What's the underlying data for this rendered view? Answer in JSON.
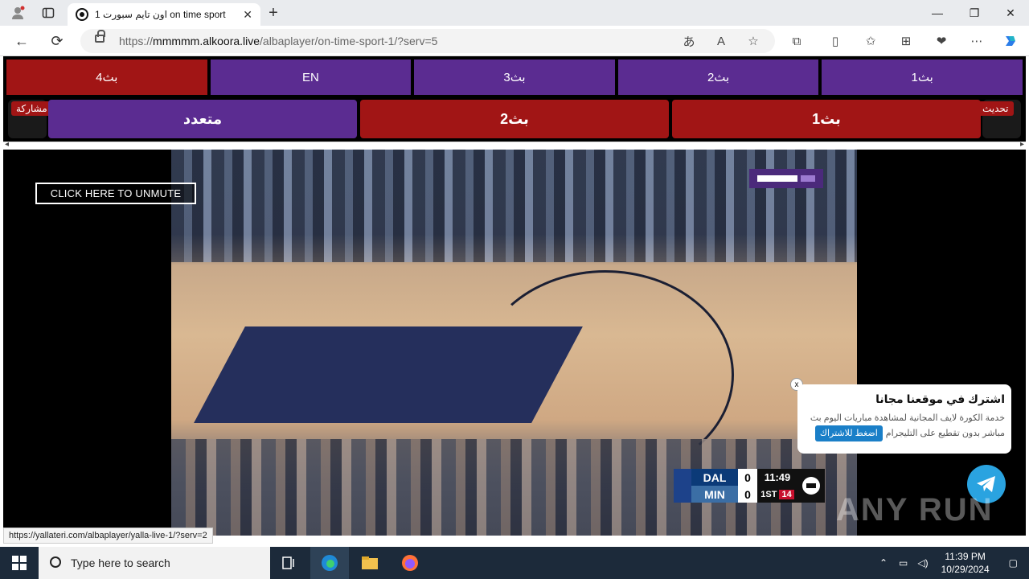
{
  "browser": {
    "tab_title": "اون تايم سبورت 1 on time sport",
    "url_prefix": "https://",
    "url_domain": "mmmmm.alkoora.live",
    "url_path": "/albaplayer/on-time-sport-1/?serv=5",
    "status_url": "https://yallateri.com/albaplayer/yalla-live-1/?serv=2"
  },
  "servers_top": [
    {
      "label": "بث4",
      "active": true
    },
    {
      "label": "EN",
      "active": false
    },
    {
      "label": "بث3",
      "active": false
    },
    {
      "label": "بث2",
      "active": false
    },
    {
      "label": "بث1",
      "active": false
    }
  ],
  "servers_main": [
    {
      "label": "متعدد",
      "color": "#5b2c91"
    },
    {
      "label": "بث2",
      "color": "#a11515"
    },
    {
      "label": "بث1",
      "color": "#a11515"
    }
  ],
  "side": {
    "share_label": "مشاركة",
    "refresh_label": "تحديث"
  },
  "player": {
    "unmute_label": "CLICK HERE TO UNMUTE"
  },
  "scoreboard": {
    "team1": "DAL",
    "team1_score": "0",
    "team2": "MIN",
    "team2_score": "0",
    "clock": "11:49",
    "quarter": "1ST",
    "shot_clock": "14"
  },
  "popup": {
    "title": "اشترك في موقعنا مجانا",
    "desc_line1": "خدمة الكورة لايف المجانية لمشاهدة مباريات اليوم بث",
    "desc_line2": "مباشر بدون تقطيع على التليجرام",
    "button": "اضغط للاشتراك",
    "close": "x"
  },
  "watermark": "ANY RUN",
  "taskbar": {
    "search_placeholder": "Type here to search",
    "time": "11:39 PM",
    "date": "10/29/2024"
  },
  "colors": {
    "purple": "#5b2c91",
    "red": "#a11515",
    "telegram": "#2aa3e0"
  }
}
